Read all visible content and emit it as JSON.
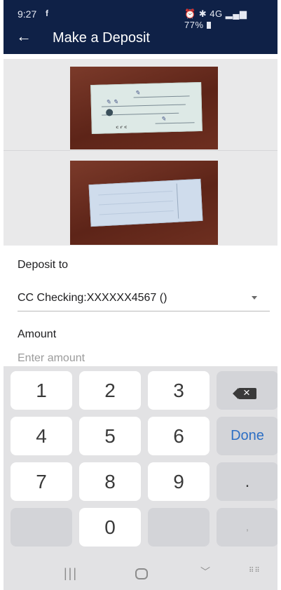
{
  "status_bar": {
    "time": "9:27",
    "facebook_icon": "f",
    "right_icons": "⏰ ✱ 4G ▂▄▆ 77%"
  },
  "header": {
    "title": "Make a Deposit",
    "back_icon": "arrow-left-icon"
  },
  "check_images": {
    "front_alt": "check-front",
    "back_alt": "check-back"
  },
  "form": {
    "deposit_to_label": "Deposit to",
    "deposit_account": "CC Checking:XXXXXX4567 ()",
    "amount_label": "Amount",
    "amount_placeholder": "Enter amount",
    "amount_value": ""
  },
  "keyboard": {
    "row1": [
      "1",
      "2",
      "3"
    ],
    "row2": [
      "4",
      "5",
      "6"
    ],
    "row3": [
      "7",
      "8",
      "9"
    ],
    "zero": "0",
    "done_label": "Done",
    "dot_label": ".",
    "comma_label": ","
  },
  "nav_bar": {
    "recent": "|||",
    "back": "﹀",
    "keyboard": "⠿⠿"
  },
  "colors": {
    "header_bg": "#0f2147",
    "done_accent": "#2d6fc4"
  }
}
